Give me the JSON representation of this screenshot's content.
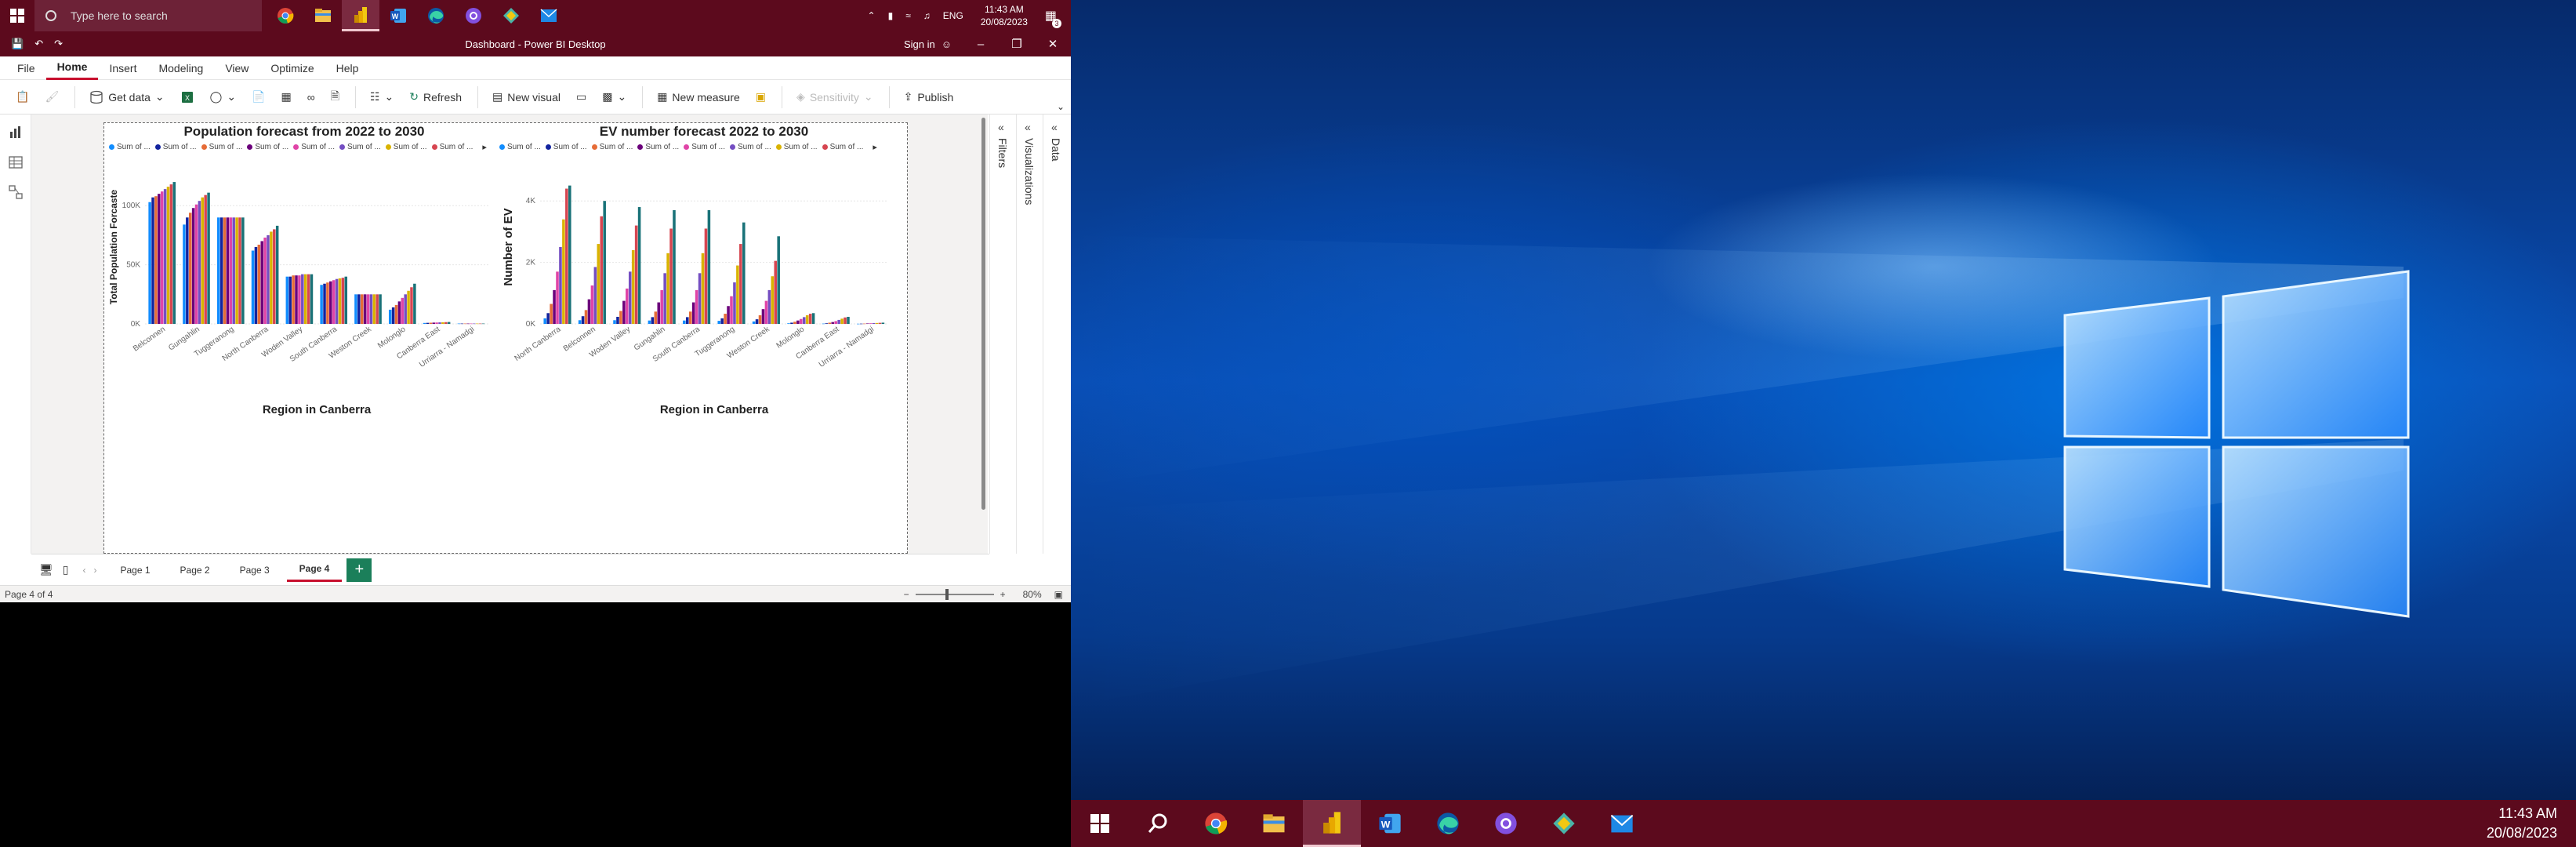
{
  "taskbar_top": {
    "search_placeholder": "Type here to search",
    "apps": [
      "chrome-icon",
      "file-explorer-icon",
      "power-bi-icon",
      "word-icon",
      "edge-icon",
      "github-icon",
      "gitkraken-icon",
      "mail-icon"
    ],
    "tray_lang": "ENG",
    "time": "11:43 AM",
    "date": "20/08/2023",
    "notification_count": "3"
  },
  "window": {
    "title": "Dashboard - Power BI Desktop",
    "signin": "Sign in"
  },
  "ribbon": {
    "tabs": [
      "File",
      "Home",
      "Insert",
      "Modeling",
      "View",
      "Optimize",
      "Help"
    ],
    "active_tab": "Home",
    "get_data": "Get data",
    "refresh": "Refresh",
    "new_visual": "New visual",
    "new_measure": "New measure",
    "sensitivity": "Sensitivity",
    "publish": "Publish"
  },
  "panes": {
    "filters": "Filters",
    "visualizations": "Visualizations",
    "data": "Data"
  },
  "page_tabs": [
    "Page 1",
    "Page 2",
    "Page 3",
    "Page 4"
  ],
  "active_page": "Page 4",
  "status": {
    "page_info": "Page 4 of 4",
    "zoom": "80%"
  },
  "legend": {
    "entry_label": "Sum of ...",
    "colors": [
      "#118DFF",
      "#12239E",
      "#E66C37",
      "#6B007B",
      "#E044A7",
      "#744EC2",
      "#D9B300",
      "#D64550",
      "#197278"
    ]
  },
  "chart_data": [
    {
      "type": "bar",
      "title": "Population forecast from 2022 to 2030",
      "xlabel": "Region in Canberra",
      "ylabel": "Total Population Forcaste",
      "ylim": [
        0,
        130000
      ],
      "yticks": [
        "0K",
        "50K",
        "100K"
      ],
      "categories": [
        "Belconnen",
        "Gungahlin",
        "Tuggeranong",
        "North Canberra",
        "Woden Valley",
        "South Canberra",
        "Weston Creek",
        "Molonglo",
        "Canberra East",
        "Urriarra - Namadgi"
      ],
      "series": [
        {
          "name": "Sum of ...",
          "values": [
            103000,
            84000,
            90000,
            62000,
            40000,
            33000,
            25000,
            12000,
            800,
            300
          ]
        },
        {
          "name": "Sum of ...",
          "values": [
            107000,
            90000,
            90000,
            65000,
            40000,
            34000,
            25000,
            14000,
            900,
            300
          ]
        },
        {
          "name": "Sum of ...",
          "values": [
            108000,
            94000,
            90000,
            67000,
            41000,
            35000,
            25000,
            16000,
            1000,
            300
          ]
        },
        {
          "name": "Sum of ...",
          "values": [
            110000,
            98000,
            90000,
            70000,
            41000,
            36000,
            25000,
            19000,
            1100,
            300
          ]
        },
        {
          "name": "Sum of ...",
          "values": [
            112000,
            101000,
            90000,
            73000,
            41000,
            37000,
            25000,
            22000,
            1200,
            300
          ]
        },
        {
          "name": "Sum of ...",
          "values": [
            114000,
            104000,
            90000,
            75000,
            42000,
            38000,
            25000,
            25000,
            1300,
            300
          ]
        },
        {
          "name": "Sum of ...",
          "values": [
            116000,
            107000,
            90000,
            78000,
            42000,
            38500,
            25000,
            28000,
            1400,
            300
          ]
        },
        {
          "name": "Sum of ...",
          "values": [
            118000,
            109000,
            90000,
            80000,
            42000,
            39000,
            25000,
            31000,
            1500,
            300
          ]
        },
        {
          "name": "Sum of ...",
          "values": [
            120000,
            111000,
            90000,
            83000,
            42000,
            40000,
            25000,
            34000,
            1600,
            300
          ]
        }
      ]
    },
    {
      "type": "bar",
      "title": "EV number forecast 2022 to 2030",
      "xlabel": "Region in Canberra",
      "ylabel": "Number of EV",
      "ylim": [
        0,
        5000
      ],
      "yticks": [
        "0K",
        "2K",
        "4K"
      ],
      "categories": [
        "North Canberra",
        "Belconnen",
        "Woden Valley",
        "Gungahlin",
        "South Canberra",
        "Tuggeranong",
        "Weston Creek",
        "Molonglo",
        "Canberra East",
        "Urriarra - Namadgi"
      ],
      "series": [
        {
          "name": "Sum of ...",
          "values": [
            180,
            120,
            120,
            110,
            110,
            100,
            80,
            20,
            10,
            5
          ]
        },
        {
          "name": "Sum of ...",
          "values": [
            350,
            250,
            230,
            220,
            220,
            180,
            150,
            40,
            20,
            8
          ]
        },
        {
          "name": "Sum of ...",
          "values": [
            650,
            450,
            420,
            400,
            400,
            330,
            280,
            70,
            40,
            10
          ]
        },
        {
          "name": "Sum of ...",
          "values": [
            1100,
            800,
            750,
            700,
            700,
            580,
            480,
            110,
            60,
            15
          ]
        },
        {
          "name": "Sum of ...",
          "values": [
            1700,
            1250,
            1150,
            1100,
            1100,
            900,
            750,
            160,
            90,
            20
          ]
        },
        {
          "name": "Sum of ...",
          "values": [
            2500,
            1850,
            1700,
            1650,
            1650,
            1350,
            1100,
            220,
            130,
            25
          ]
        },
        {
          "name": "Sum of ...",
          "values": [
            3400,
            2600,
            2400,
            2300,
            2300,
            1900,
            1550,
            280,
            170,
            30
          ]
        },
        {
          "name": "Sum of ...",
          "values": [
            4400,
            3500,
            3200,
            3100,
            3100,
            2600,
            2050,
            330,
            210,
            35
          ]
        },
        {
          "name": "Sum of ...",
          "values": [
            4500,
            4000,
            3800,
            3700,
            3700,
            3300,
            2850,
            350,
            230,
            40
          ]
        }
      ]
    }
  ],
  "taskbar_bottom": {
    "apps": [
      "search-icon",
      "chrome-icon",
      "file-explorer-icon",
      "power-bi-icon",
      "word-icon",
      "edge-icon",
      "github-icon",
      "gitkraken-icon",
      "mail-icon"
    ],
    "time": "11:43 AM",
    "date": "20/08/2023"
  }
}
